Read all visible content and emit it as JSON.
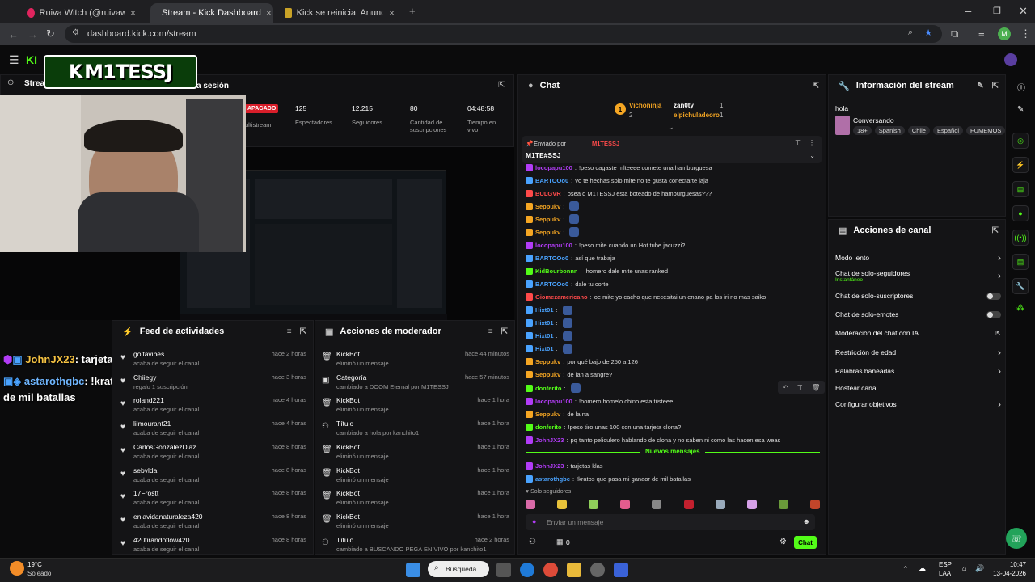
{
  "browser": {
    "tabs": [
      {
        "title": "Ruiva Witch (@ruivawitch) | All"
      },
      {
        "title": "Stream - Kick Dashboard"
      },
      {
        "title": "Kick se reinicia: Anuncios no in"
      }
    ],
    "url": "dashboard.kick.com/stream",
    "profile_initial": "M"
  },
  "overlay": {
    "streamer_logo": "M1TESSJ",
    "stream_label": "Stream",
    "session_label": "a sesión",
    "caption_1_user": "JohnJX23",
    "caption_1_text": ": tarjetas klas",
    "caption_2_user": "astarothgbc",
    "caption_2_text": ": !kratos que pasa mi ganaor de mil batallas"
  },
  "stats": {
    "status": "APAGADO",
    "status_sub": "ultistream",
    "items": [
      {
        "value": "125",
        "label": "Espectadores"
      },
      {
        "value": "12.215",
        "label": "Seguidores"
      },
      {
        "value": "80",
        "label": "Cantidad de suscripciones"
      },
      {
        "value": "04:48:58",
        "label": "Tiempo en vivo"
      }
    ]
  },
  "activity_feed": {
    "title": "Feed de actividades",
    "rows": [
      {
        "name": "goltavibes",
        "sub": "acaba de seguir el canal",
        "time": "hace 2 horas"
      },
      {
        "name": "Chiiegy",
        "sub": "regalo 1 suscripción",
        "time": "hace 3 horas"
      },
      {
        "name": "roland221",
        "sub": "acaba de seguir el canal",
        "time": "hace 4 horas"
      },
      {
        "name": "lilmourant21",
        "sub": "acaba de seguir el canal",
        "time": "hace 4 horas"
      },
      {
        "name": "CarlosGonzalezDiaz",
        "sub": "acaba de seguir el canal",
        "time": "hace 8 horas"
      },
      {
        "name": "sebvlda",
        "sub": "acaba de seguir el canal",
        "time": "hace 8 horas"
      },
      {
        "name": "17Frostt",
        "sub": "acaba de seguir el canal",
        "time": "hace 8 horas"
      },
      {
        "name": "enlavidanaturaleza420",
        "sub": "acaba de seguir el canal",
        "time": "hace 8 horas"
      },
      {
        "name": "420tirandoflow420",
        "sub": "acaba de seguir el canal",
        "time": "hace 8 horas"
      }
    ]
  },
  "mod_actions": {
    "title": "Acciones de moderador",
    "rows": [
      {
        "name": "KickBot",
        "sub": "eliminó un mensaje",
        "time": "hace 44 minutos"
      },
      {
        "name": "Categoría",
        "sub": "cambiado a DOOM Eternal por M1TESSJ",
        "time": "hace 57 minutos"
      },
      {
        "name": "KickBot",
        "sub": "eliminó un mensaje",
        "time": "hace 1 hora"
      },
      {
        "name": "Título",
        "sub": "cambiado a hola por kanchito1",
        "time": "hace 1 hora"
      },
      {
        "name": "KickBot",
        "sub": "eliminó un mensaje",
        "time": "hace 1 hora"
      },
      {
        "name": "KickBot",
        "sub": "eliminó un mensaje",
        "time": "hace 1 hora"
      },
      {
        "name": "KickBot",
        "sub": "eliminó un mensaje",
        "time": "hace 1 hora"
      },
      {
        "name": "KickBot",
        "sub": "eliminó un mensaje",
        "time": "hace 1 hora"
      },
      {
        "name": "Título",
        "sub": "cambiado a BUSCANDO PEGA EN VIVO por kanchito1",
        "time": "hace 2 horas"
      }
    ]
  },
  "chat": {
    "title": "Chat",
    "top_gifters": [
      {
        "name": "Vichoninja",
        "count": "2"
      },
      {
        "name": "zan0ty",
        "count": "1"
      },
      {
        "name": "elpichuladeoro",
        "count": "1"
      }
    ],
    "pinned_label": "Enviado por",
    "pinned_by": "M1TESSJ",
    "pinned_text": "M1TE#SSJ",
    "messages": [
      {
        "user": "locopapu100",
        "text": "!peso cagaste mlteeee comete una hamburguesa",
        "color": "#b23cf7"
      },
      {
        "user": "BARTOOo0",
        "text": "vo te hechas solo mite no te gusta conectarte jaja",
        "color": "#4aa3ff"
      },
      {
        "user": "BULGVR",
        "text": "osea q M1TESSJ esta boteado de hamburguesas???",
        "color": "#ff4a4a"
      },
      {
        "user": "Seppukv",
        "text": "",
        "color": "#f5a623"
      },
      {
        "user": "Seppukv",
        "text": "",
        "color": "#f5a623"
      },
      {
        "user": "Seppukv",
        "text": "",
        "color": "#f5a623"
      },
      {
        "user": "locopapu100",
        "text": "!peso mite cuando un Hot tube jacuzzi?",
        "color": "#b23cf7"
      },
      {
        "user": "BARTOOo0",
        "text": "así que trabaja",
        "color": "#4aa3ff"
      },
      {
        "user": "KidBourbonnn",
        "text": "!homero dale mite unas ranked",
        "color": "#53fc18"
      },
      {
        "user": "BARTOOo0",
        "text": "dale tu corte",
        "color": "#4aa3ff"
      },
      {
        "user": "Giomezamericano",
        "text": "oe mite yo cacho que necesitai un enano pa los iri no mas saiko",
        "color": "#ff4a4a"
      },
      {
        "user": "Hixt01",
        "text": "",
        "color": "#4aa3ff"
      },
      {
        "user": "Hixt01",
        "text": "",
        "color": "#4aa3ff"
      },
      {
        "user": "Hixt01",
        "text": "",
        "color": "#4aa3ff"
      },
      {
        "user": "Hixt01",
        "text": "",
        "color": "#4aa3ff"
      },
      {
        "user": "Seppukv",
        "text": "por qué bajo de 250 a 126",
        "color": "#f5a623"
      },
      {
        "user": "Seppukv",
        "text": "de lan a sangre?",
        "color": "#f5a623"
      },
      {
        "user": "donferito",
        "text": "",
        "color": "#53fc18"
      },
      {
        "user": "locopapu100",
        "text": "!homero homelo chino esta tiisteee",
        "color": "#b23cf7"
      },
      {
        "user": "Seppukv",
        "text": "de la na",
        "color": "#f5a623"
      },
      {
        "user": "donferito",
        "text": "!peso tiro unas 100 con una tarjeta clona?",
        "color": "#53fc18"
      },
      {
        "user": "JohnJX23",
        "text": "pq tanto peliculero hablando de clona y no saben ni como las hacen esa weas",
        "color": "#b23cf7"
      }
    ],
    "new_messages_label": "Nuevos mensajes",
    "new_messages": [
      {
        "user": "JohnJX23",
        "text": "tarjetas klas",
        "color": "#b23cf7"
      },
      {
        "user": "astarothgbc",
        "text": "!kratos que pasa mi ganaor de mil batallas",
        "color": "#4aa3ff"
      }
    ],
    "followers_only": "Solo seguidores",
    "input_placeholder": "Enviar un mensaje",
    "count": "0",
    "send_label": "Chat"
  },
  "stream_info": {
    "title": "Información del stream",
    "stream_title": "hola",
    "category": "Conversando",
    "tags": [
      "18+",
      "Spanish",
      "Chile",
      "Español",
      "FUMEMOS"
    ]
  },
  "channel_actions": {
    "title": "Acciones de canal",
    "items": [
      {
        "label": "Modo lento",
        "type": "chevron"
      },
      {
        "label": "Chat de solo-seguidores",
        "sub": "Instantáneo",
        "type": "chevron"
      },
      {
        "label": "Chat de solo-suscriptores",
        "type": "toggle"
      },
      {
        "label": "Chat de solo-emotes",
        "type": "toggle"
      },
      {
        "label": "Moderación del chat con IA",
        "type": "external"
      },
      {
        "label": "Restricción de edad",
        "type": "chevron"
      },
      {
        "label": "Palabras baneadas",
        "type": "chevron"
      },
      {
        "label": "Hostear canal",
        "type": "none"
      },
      {
        "label": "Configurar objetivos",
        "type": "chevron"
      }
    ]
  },
  "taskbar": {
    "weather_temp": "19°C",
    "weather_text": "Soleado",
    "search_label": "Búsqueda",
    "lang": "ESP",
    "lang_sub": "LAA",
    "time": "10:47",
    "date": "13-04-2026"
  },
  "colors": {
    "accent": "#53fc18",
    "bg": "#0b0b0c",
    "panel": "#141416"
  }
}
